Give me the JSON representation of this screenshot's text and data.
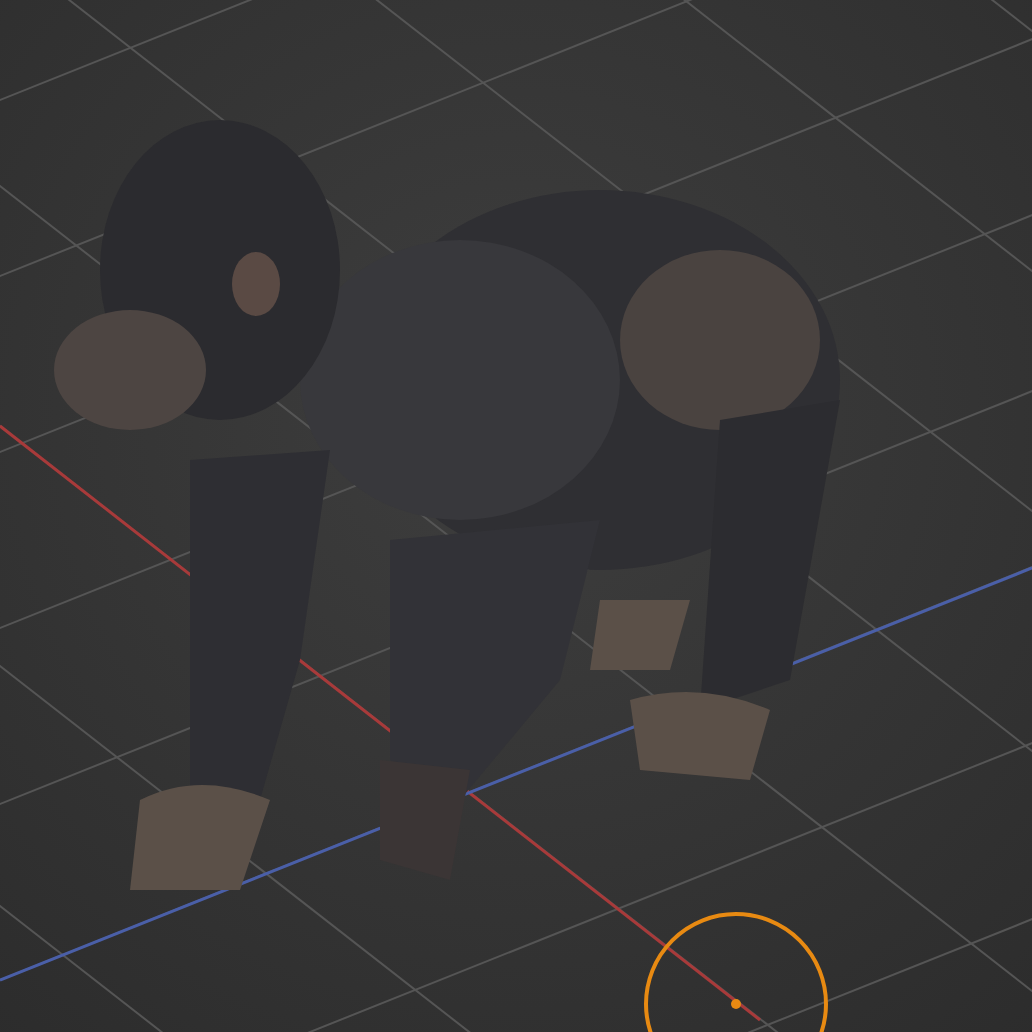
{
  "viewport": {
    "grid": true,
    "axes": true,
    "cursor": true
  }
}
